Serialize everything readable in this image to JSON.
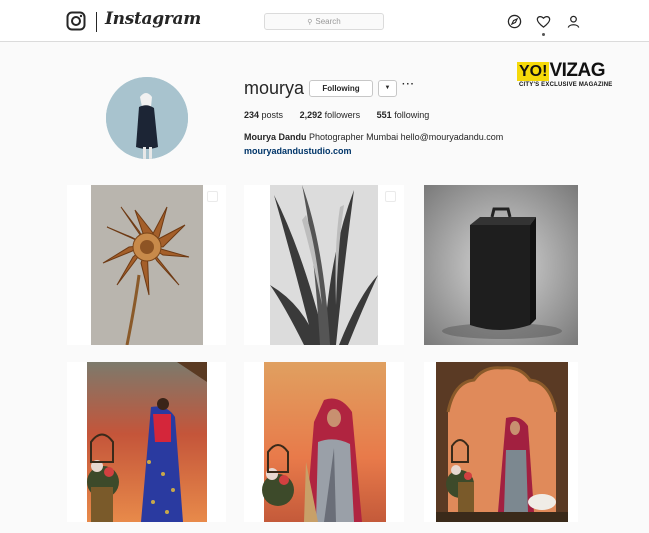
{
  "nav": {
    "brand": "Instagram",
    "search_placeholder": "Search"
  },
  "profile": {
    "username": "mourya",
    "follow_label": "Following",
    "posts_count": "234",
    "posts_label": "posts",
    "followers_count": "2,292",
    "followers_label": "followers",
    "following_count": "551",
    "following_label": "following",
    "full_name": "Mourya Dandu",
    "bio": "Photographer Mumbai hello@mouryadandu.com",
    "website": "mouryadandustudio.com"
  },
  "watermark": {
    "yo": "YO!",
    "vizag": "VIZAG",
    "tagline": "CITY'S EXCLUSIVE MAGAZINE"
  },
  "posts": [
    {
      "subject": "dried flower"
    },
    {
      "subject": "agave leaves black and white"
    },
    {
      "subject": "black box sculpture"
    },
    {
      "subject": "woman in blue saree back view"
    },
    {
      "subject": "woman in red veil and saree"
    },
    {
      "subject": "woman under arched frame"
    }
  ]
}
